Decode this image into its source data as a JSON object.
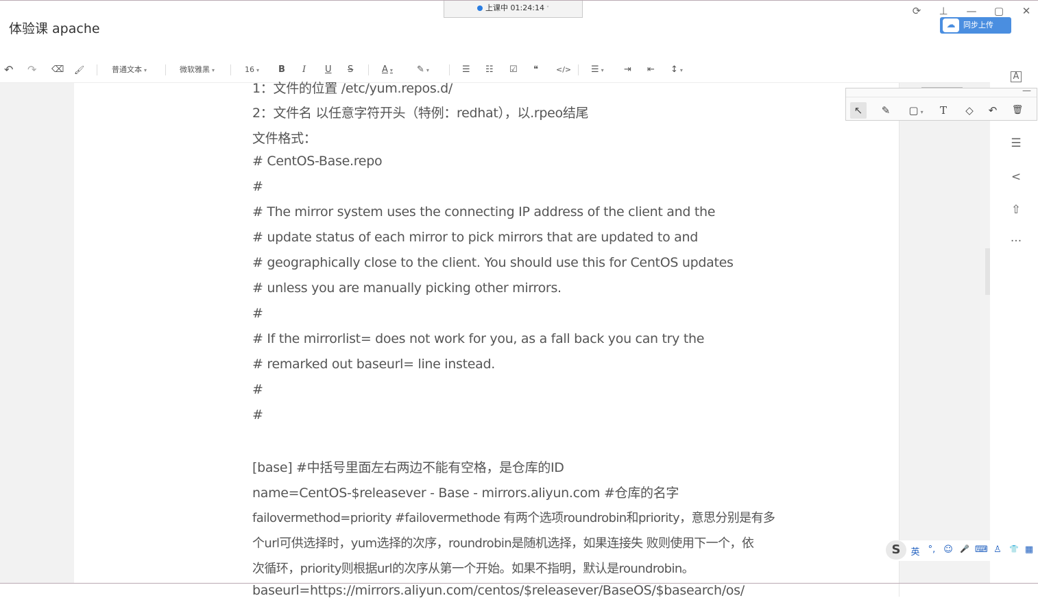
{
  "app": {
    "title": "体验课 apache",
    "timer_text": "上课中 01:24:14",
    "cloud_button_label": "同步上传"
  },
  "window_controls": {
    "refresh": "⟳",
    "pin": "⊥",
    "minimize": "—",
    "maximize": "▢",
    "close": "✕"
  },
  "toolbar": {
    "undo": "↶",
    "redo": "↷",
    "eraser": "⌫",
    "format_painter": "🖌",
    "paragraph_style": "普通文本",
    "font_family": "微软雅黑",
    "font_size": "16",
    "bold": "B",
    "italic": "I",
    "underline": "U",
    "strike": "S",
    "font_color": "A",
    "highlight": "✎",
    "bullet_list": "☰",
    "ordered_list": "☷",
    "checkbox": "☑",
    "quote": "❝",
    "code": "</>",
    "align": "☰",
    "indent": "⇥",
    "outdent": "⇤",
    "line_height": "↕"
  },
  "annotation_tools": {
    "select": "↖",
    "pen": "✎",
    "rectangle": "▢",
    "text": "T",
    "eraser": "◇",
    "undo": "↶",
    "delete": "🗑",
    "minimize": "—"
  },
  "right_rail": {
    "outline_icon": "A",
    "doc_icon": "☰",
    "share_icon": "<",
    "export_icon": "⇧",
    "more_icon": "···"
  },
  "document": {
    "lines": [
      "1：文件的位置        /etc/yum.repos.d/",
      "2：文件名    以任意字符开头（特例：redhat），以.rpeo结尾",
      "文件格式：",
      "# CentOS-Base.repo",
      "#",
      "# The mirror system uses the connecting IP address of the client and the",
      "# update status of each mirror to pick mirrors that are updated to and",
      "# geographically close to the client.  You should use this for CentOS updates",
      "# unless you are manually picking other mirrors.",
      "#",
      "# If the mirrorlist= does not work for you, as a fall back you can try the",
      "# remarked out baseurl= line instead.",
      "#",
      "#",
      "",
      "[base]  #中括号里面左右两边不能有空格，是仓库的ID",
      "name=CentOS-$releasever - Base - mirrors.aliyun.com   #仓库的名字",
      "failovermethod=priority #failovermethode 有两个选项roundrobin和priority，意思分别是有多",
      "个url可供选择时，yum选择的次序，roundrobin是随机选择，如果连接失 败则使用下一个，依",
      "次循环，priority则根据url的次序从第一个开始。如果不指明，默认是roundrobin。",
      "baseurl=https://mirrors.aliyun.com/centos/$releasever/BaseOS/$basearch/os/"
    ]
  },
  "ime": {
    "logo": "S",
    "lang": "英",
    "punct": "°,",
    "emoji": "☺",
    "voice": "🎤",
    "keyboard": "⌨",
    "person": "♙",
    "skin": "👕",
    "tools": "▦"
  }
}
